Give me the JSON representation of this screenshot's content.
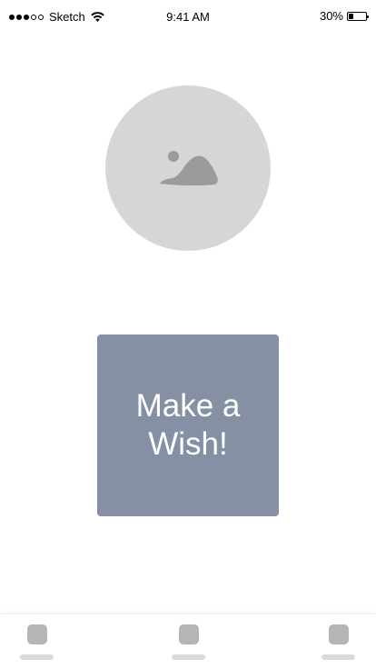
{
  "status_bar": {
    "carrier": "Sketch",
    "time": "9:41 AM",
    "battery_percent": "30%",
    "battery_level": 0.3,
    "signal_bars_filled": 3,
    "signal_bars_total": 5
  },
  "avatar": {
    "icon": "image-placeholder-icon",
    "color": "#d6d6d6"
  },
  "main": {
    "wish_button_label": "Make a Wish!",
    "wish_button_color": "#8590a5"
  },
  "tab_bar": {
    "tabs": [
      {
        "icon": "tab-icon-placeholder"
      },
      {
        "icon": "tab-icon-placeholder"
      },
      {
        "icon": "tab-icon-placeholder"
      }
    ]
  }
}
